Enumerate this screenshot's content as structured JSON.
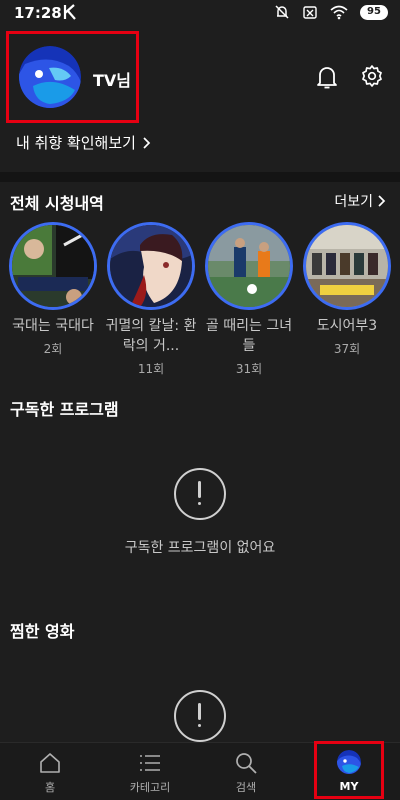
{
  "status_bar": {
    "time": "17:28",
    "battery": "95",
    "icons": [
      "app-k-icon",
      "mute-icon",
      "no-sim-icon",
      "wifi-icon",
      "battery-icon"
    ]
  },
  "header": {
    "profile_name": "TV님",
    "notification_icon": "bell-icon",
    "settings_icon": "gear-icon"
  },
  "taste_link": {
    "label": "내 취향 확인해보기",
    "icon": "chevron-right-icon"
  },
  "history": {
    "title": "전체 시청내역",
    "more_label": "더보기",
    "items": [
      {
        "title": "국대는 국대다",
        "count": "2회"
      },
      {
        "title": "귀멸의 칼날: 환락의 거...",
        "count": "11회"
      },
      {
        "title": "골 때리는 그녀들",
        "count": "31회"
      },
      {
        "title": "도시어부3",
        "count": "37회"
      }
    ]
  },
  "subscriptions": {
    "title": "구독한 프로그램",
    "empty_message": "구독한 프로그램이 없어요"
  },
  "favorites": {
    "title": "찜한 영화"
  },
  "bottom_nav": {
    "items": [
      {
        "label": "홈",
        "icon": "home-icon"
      },
      {
        "label": "카테고리",
        "icon": "menu-icon"
      },
      {
        "label": "검색",
        "icon": "search-icon"
      },
      {
        "label": "MY",
        "icon": "profile-avatar-icon"
      }
    ],
    "active": "MY"
  },
  "colors": {
    "background": "#1e1e1e",
    "accent_ring": "#3d6cf2",
    "highlight_box": "#e60012"
  }
}
